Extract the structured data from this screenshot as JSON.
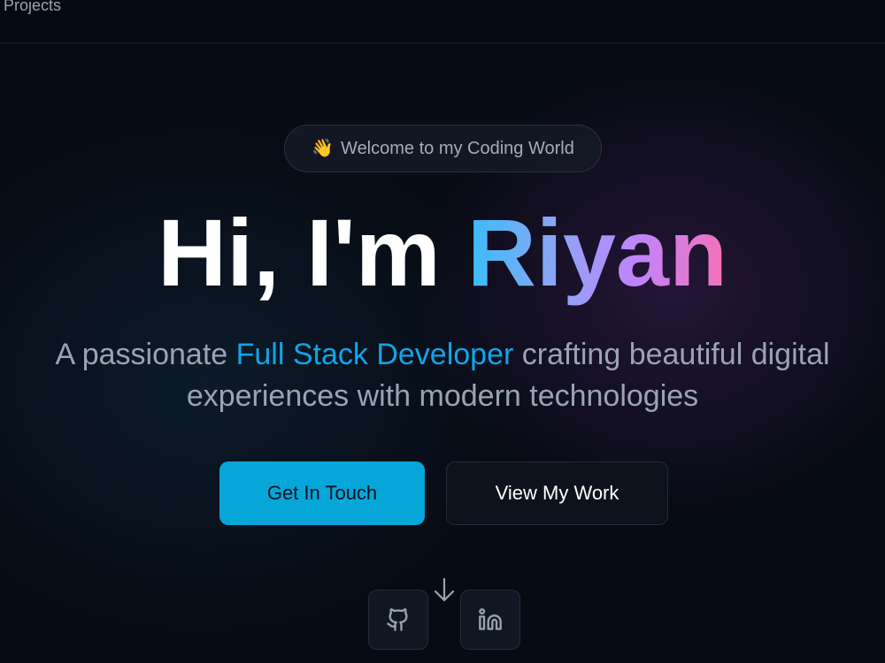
{
  "nav": {
    "projects_label": "Projects"
  },
  "hero": {
    "badge_icon": "waving-hand-icon",
    "badge_emoji": "👋",
    "badge_text": "Welcome to my Coding World",
    "title_prefix": "Hi, I'm ",
    "title_name": "Riyan",
    "subtitle_before": "A passionate ",
    "subtitle_highlight": "Full Stack Developer",
    "subtitle_after": " crafting beautiful digital experiences with modern technologies",
    "primary_button": "Get In Touch",
    "secondary_button": "View My Work"
  },
  "social": {
    "github_icon": "github-icon",
    "linkedin_icon": "linkedin-icon",
    "scroll_icon": "arrow-down-icon"
  },
  "colors": {
    "background": "#070b14",
    "accent": "#06a6d9",
    "highlight": "#0ea5e9",
    "gradient": [
      "#38bdf8",
      "#c084fc",
      "#f472b6"
    ]
  }
}
